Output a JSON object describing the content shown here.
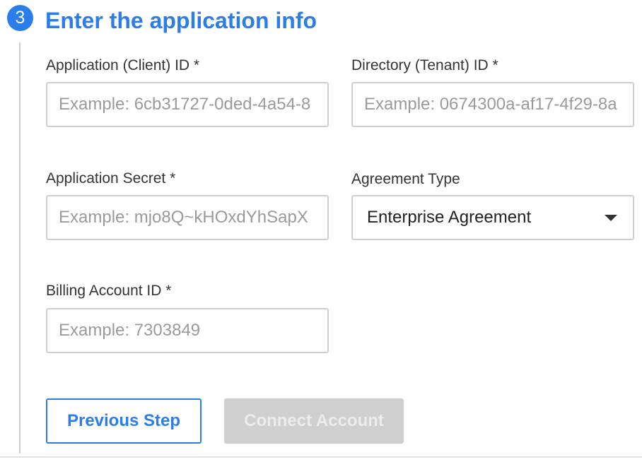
{
  "step": {
    "number": "3",
    "title": "Enter the application info"
  },
  "form": {
    "client_id": {
      "label": "Application (Client) ID *",
      "placeholder": "Example: 6cb31727-0ded-4a54-8",
      "value": ""
    },
    "tenant_id": {
      "label": "Directory (Tenant) ID *",
      "placeholder": "Example: 0674300a-af17-4f29-8a",
      "value": ""
    },
    "secret": {
      "label": "Application Secret *",
      "placeholder": "Example: mjo8Q~kHOxdYhSapX",
      "value": ""
    },
    "agreement_type": {
      "label": "Agreement Type",
      "selected": "Enterprise Agreement"
    },
    "billing_account_id": {
      "label": "Billing Account ID *",
      "placeholder": "Example: 7303849",
      "value": ""
    }
  },
  "actions": {
    "previous_label": "Previous Step",
    "connect_label": "Connect Account",
    "connect_enabled": false
  },
  "colors": {
    "accent": "#2b7de9",
    "border": "#cfcfcf",
    "disabled_bg": "#cfcfcf",
    "text": "#333333",
    "placeholder": "#9a9a9a"
  },
  "icons": {
    "dropdown": "caret-down-icon"
  }
}
